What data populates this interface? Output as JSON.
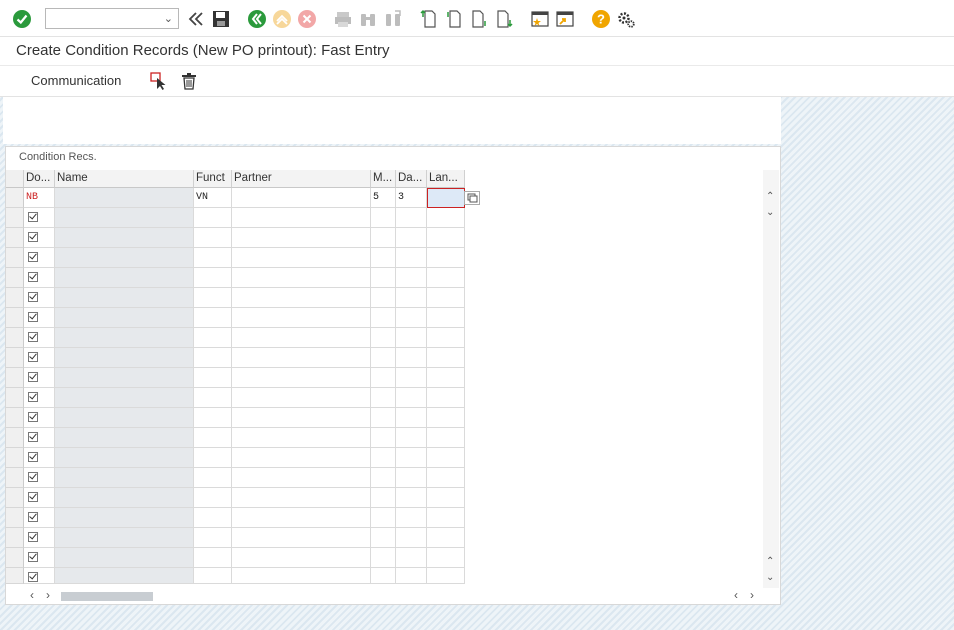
{
  "toolbar": {
    "command_field_value": "",
    "icons": [
      "enter-icon",
      "back-icon",
      "save-icon",
      "back-green-icon",
      "exit-icon",
      "cancel-icon",
      "print-icon",
      "find-icon",
      "find-next-icon",
      "first-page-icon",
      "prev-page-icon",
      "next-page-icon",
      "last-page-icon",
      "create-session-icon",
      "shortcut-icon",
      "help-icon",
      "settings-icon"
    ]
  },
  "title": "Create Condition Records (New PO printout): Fast Entry",
  "app_toolbar": {
    "communication_label": "Communication"
  },
  "panel": {
    "title": "Condition Recs."
  },
  "table": {
    "columns": [
      "Do...",
      "Name",
      "Funct",
      "Partner",
      "M...",
      "Da...",
      "Lan..."
    ],
    "first_row": {
      "doc_type": "NB",
      "name": "",
      "funct": "VN",
      "partner": "",
      "medium": "5",
      "date": "3",
      "lang": ""
    }
  },
  "colors": {
    "accent_green": "#2b9a3c",
    "help": "#f0a500",
    "error_red": "#cc2222"
  }
}
